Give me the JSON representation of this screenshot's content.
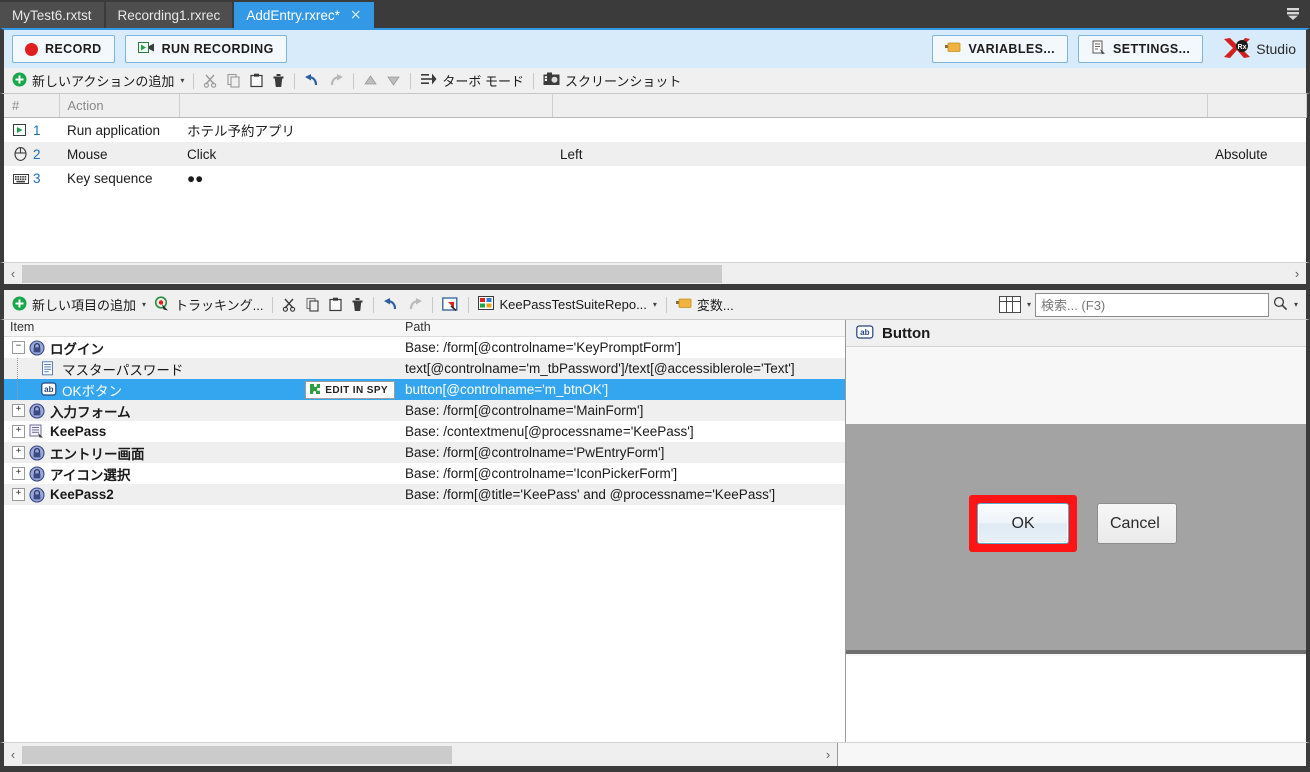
{
  "tabs": [
    {
      "label": "MyTest6.rxtst",
      "active": false,
      "closable": false
    },
    {
      "label": "Recording1.rxrec",
      "active": false,
      "closable": false
    },
    {
      "label": "AddEntry.rxrec*",
      "active": true,
      "closable": true,
      "close_glyph": "×"
    }
  ],
  "commandbar": {
    "record_label": "RECORD",
    "run_recording_label": "RUN RECORDING",
    "variables_label": "VARIABLES...",
    "settings_label": "SETTINGS...",
    "studio_label": "Studio"
  },
  "action_toolbar": {
    "add_action_label": "新しいアクションの追加",
    "turbo_label": "ターボ モード",
    "screenshot_label": "スクリーンショット",
    "caret": "▾"
  },
  "actions_table": {
    "columns": [
      "#",
      "Action",
      "",
      "",
      ""
    ],
    "rows": [
      {
        "icon": "run-application-icon",
        "num": "1",
        "action": "Run application",
        "detail": "ホテル予約アプリ",
        "extra": "",
        "extra2": ""
      },
      {
        "icon": "mouse-icon",
        "num": "2",
        "action": "Mouse",
        "detail": "Click",
        "extra": "Left",
        "extra2": "Absolute"
      },
      {
        "icon": "keyboard-icon",
        "num": "3",
        "action": "Key sequence",
        "detail": "●●",
        "extra": "",
        "extra2": ""
      }
    ]
  },
  "repo_toolbar": {
    "add_item_label": "新しい項目の追加",
    "tracking_label": "トラッキング...",
    "repository_label": "KeePassTestSuiteRepo...",
    "variables_label": "変数...",
    "caret": "▾"
  },
  "search": {
    "placeholder": "検索... (F3)",
    "value": ""
  },
  "tree": {
    "headers": {
      "item": "Item",
      "path": "Path"
    },
    "rows": [
      {
        "label": "ログイン",
        "path": "Base: /form[@controlname='KeyPromptForm']",
        "level": 0,
        "bold": true,
        "expander": "−",
        "icon": "lock-folder-icon",
        "selected": false,
        "alt": false
      },
      {
        "label": "マスターパスワード",
        "path": "text[@controlname='m_tbPassword']/text[@accessiblerole='Text']",
        "level": 1,
        "bold": false,
        "expander": "",
        "icon": "text-element-icon",
        "selected": false,
        "alt": true
      },
      {
        "label": "OKボタン",
        "path": "button[@controlname='m_btnOK']",
        "level": 1,
        "bold": false,
        "expander": "",
        "icon": "button-element-icon",
        "selected": true,
        "alt": false,
        "badge": "EDIT IN SPY"
      },
      {
        "label": "入力フォーム",
        "path": "Base: /form[@controlname='MainForm']",
        "level": 0,
        "bold": true,
        "expander": "+",
        "icon": "lock-folder-icon",
        "selected": false,
        "alt": true
      },
      {
        "label": "KeePass",
        "path": "Base: /contextmenu[@processname='KeePass']",
        "level": 0,
        "bold": true,
        "expander": "+",
        "icon": "contextmenu-icon",
        "selected": false,
        "alt": false
      },
      {
        "label": "エントリー画面",
        "path": "Base: /form[@controlname='PwEntryForm']",
        "level": 0,
        "bold": true,
        "expander": "+",
        "icon": "lock-folder-icon",
        "selected": false,
        "alt": true
      },
      {
        "label": "アイコン選択",
        "path": "Base: /form[@controlname='IconPickerForm']",
        "level": 0,
        "bold": true,
        "expander": "+",
        "icon": "lock-folder-icon",
        "selected": false,
        "alt": false
      },
      {
        "label": "KeePass2",
        "path": "Base: /form[@title='KeePass' and @processname='KeePass']",
        "level": 0,
        "bold": true,
        "expander": "+",
        "icon": "lock-folder-icon",
        "selected": false,
        "alt": true
      }
    ]
  },
  "preview": {
    "title": "Button",
    "ok_button_label": "OK",
    "cancel_button_label": "Cancel",
    "highlight_color": "#fd1414"
  },
  "scrollbars": {
    "left_arrow": "‹",
    "right_arrow": "›"
  },
  "colors": {
    "accent": "#3399e6",
    "selection": "#34a6f0",
    "chrome": "#3b3b3b",
    "commandbar": "#d8ebfa"
  }
}
